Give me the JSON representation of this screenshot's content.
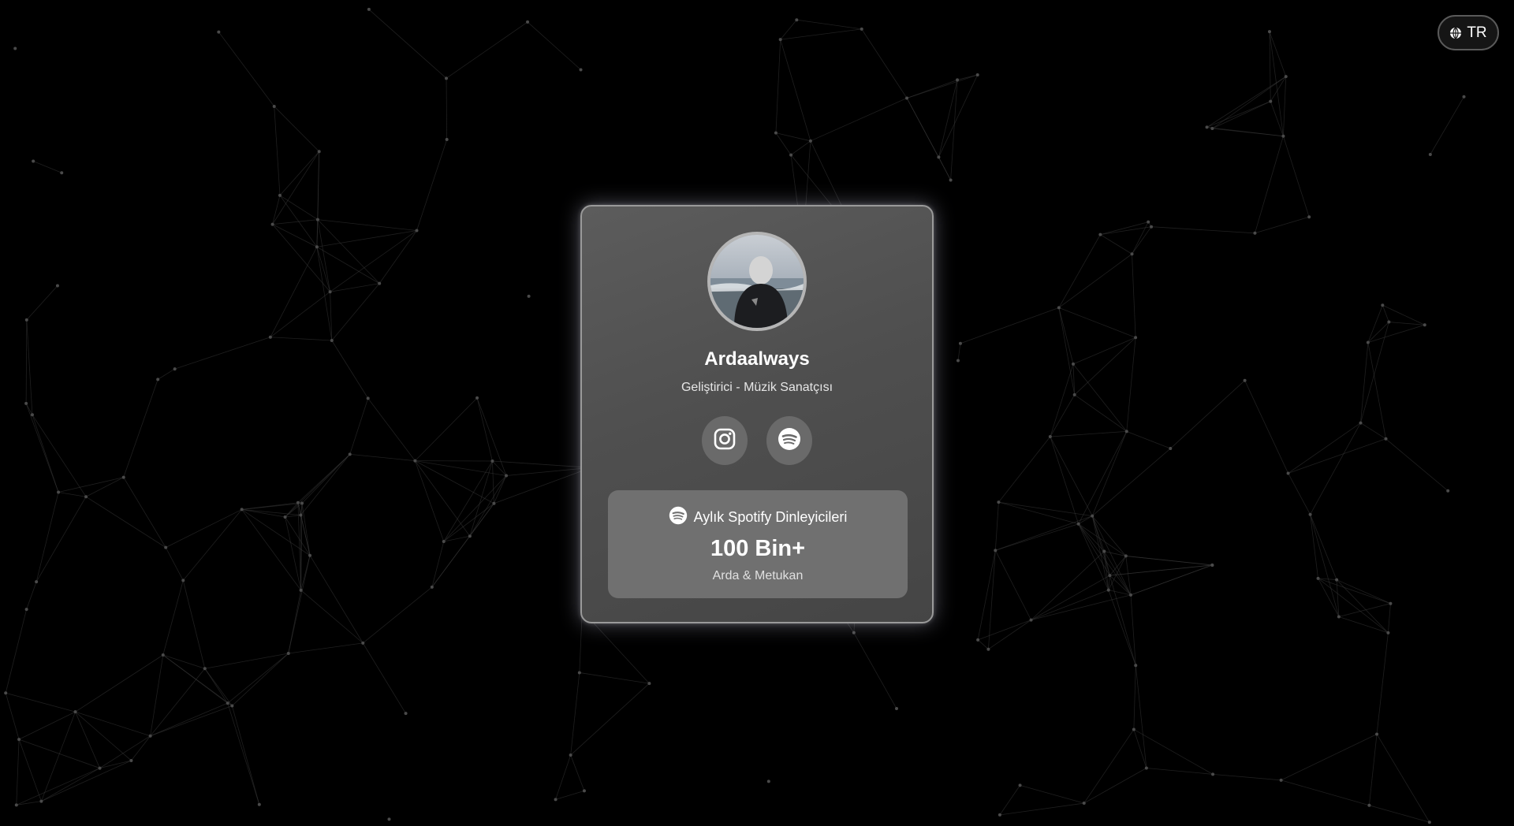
{
  "lang_toggle": {
    "label": "TR",
    "icon": "globe-icon"
  },
  "profile": {
    "name": "Ardaalways",
    "subtitle": "Geliştirici - Müzik Sanatçısı",
    "avatar_icon": "profile-photo"
  },
  "social": [
    {
      "name": "Instagram",
      "icon": "instagram-icon"
    },
    {
      "name": "Spotify",
      "icon": "spotify-icon"
    }
  ],
  "stats": {
    "heading": "Aylık Spotify Dinleyicileri",
    "value": "100 Bin+",
    "label": "Arda & Metukan",
    "icon": "spotify-icon"
  },
  "colors": {
    "background": "#000000",
    "card": "#555555",
    "stats_panel": "#707070",
    "network_line": "#3a3a3a"
  }
}
